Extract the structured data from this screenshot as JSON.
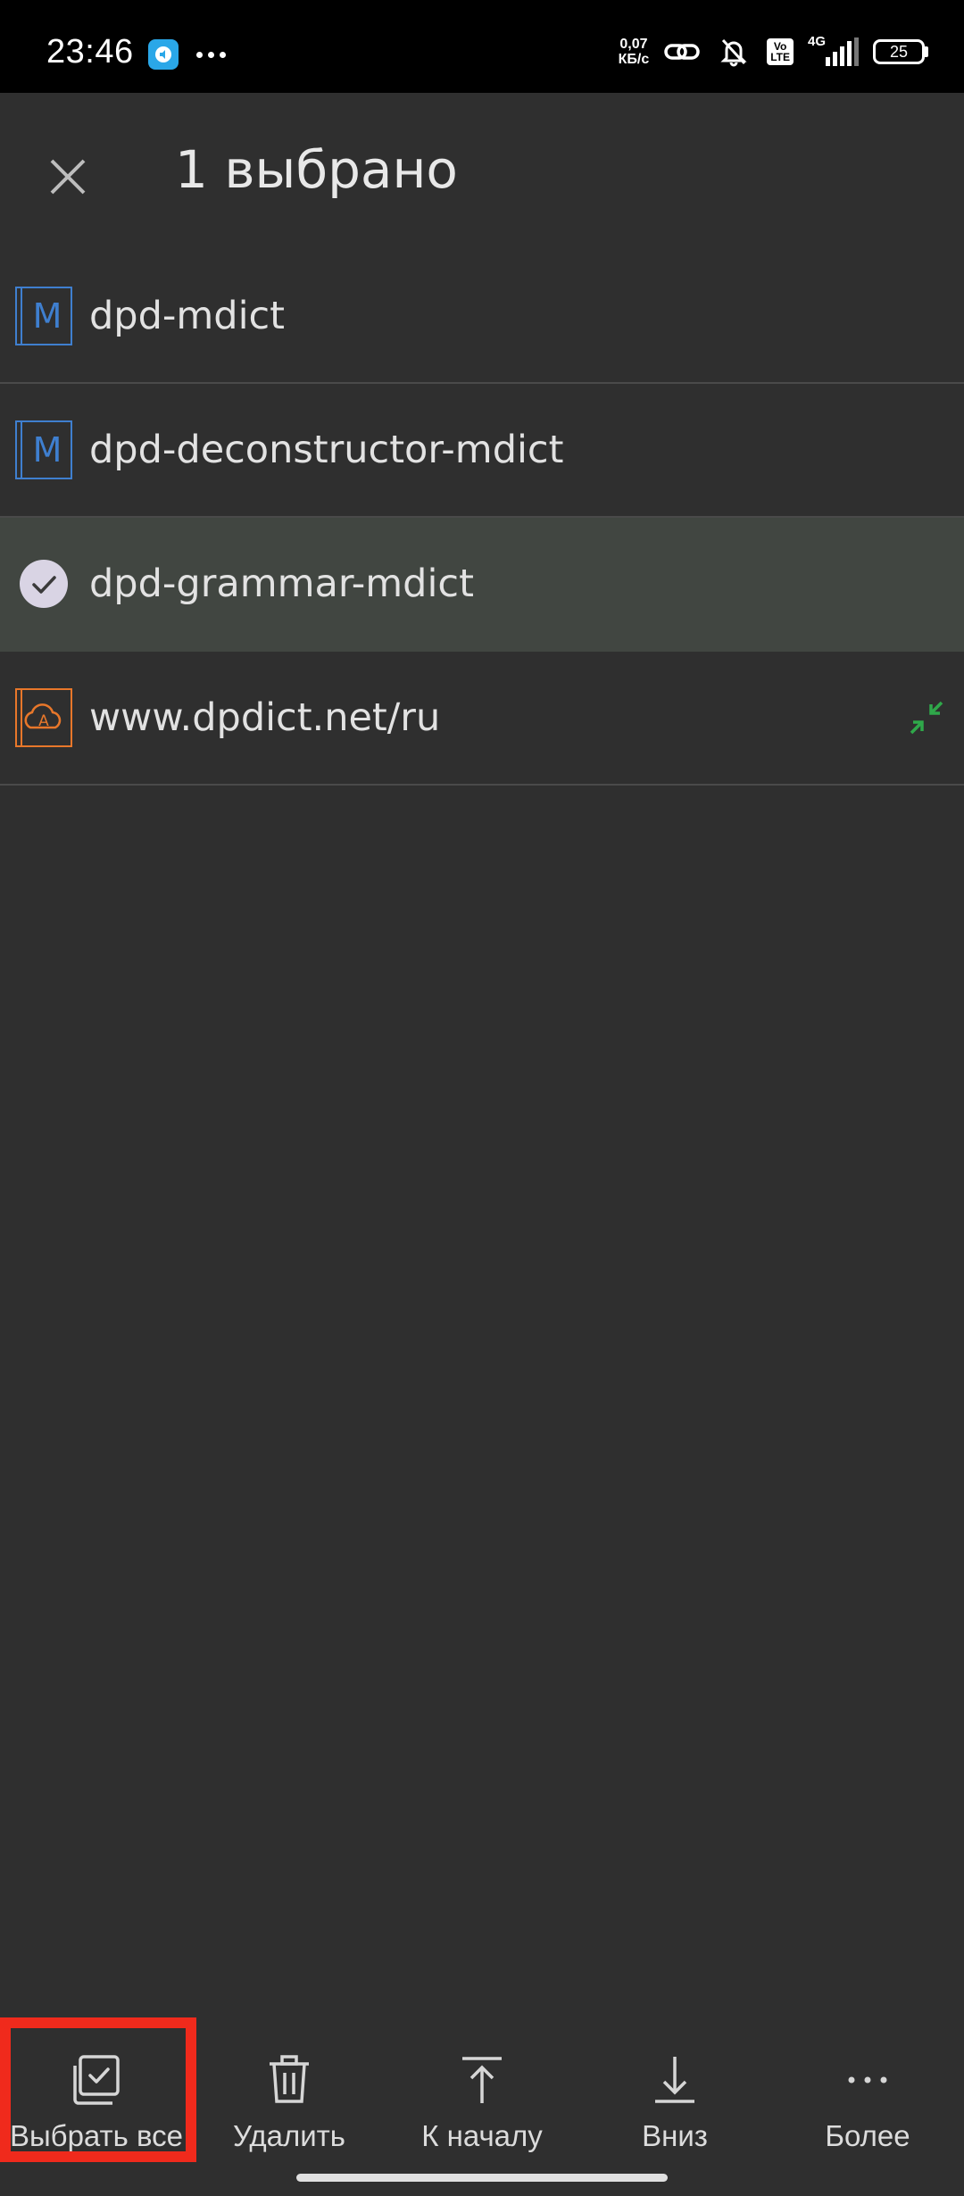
{
  "status_bar": {
    "time": "23:46",
    "net_speed_value": "0,07",
    "net_speed_unit": "КБ/с",
    "volte_top": "Vo",
    "volte_bottom": "LTE",
    "network_type": "4G",
    "battery": "25",
    "icons": [
      "app-notification-icon",
      "more-notifications-icon",
      "link-icon",
      "bell-off-icon",
      "volte-icon",
      "signal-icon",
      "battery-icon"
    ]
  },
  "header": {
    "title": "1 выбрано",
    "close_icon": "close-icon"
  },
  "list": {
    "items": [
      {
        "label": "dpd-mdict",
        "icon": "mdict-icon",
        "selected": false
      },
      {
        "label": "dpd-deconstructor-mdict",
        "icon": "mdict-icon",
        "selected": false
      },
      {
        "label": "dpd-grammar-mdict",
        "icon": "check-circle-icon",
        "selected": true
      },
      {
        "label": "www.dpdict.net/ru",
        "icon": "online-dict-icon",
        "trailing_icon": "collapse-icon",
        "selected": false
      }
    ]
  },
  "toolbar": {
    "select_all": "Выбрать все",
    "delete": "Удалить",
    "to_top": "К началу",
    "down": "Вниз",
    "more": "Более"
  },
  "colors": {
    "background": "#2f2f2f",
    "selected_row": "#414641",
    "mdict_blue": "#3f7fcf",
    "online_orange": "#e8772a",
    "collapse_green": "#2fa84a",
    "highlight_red": "#f02a1c"
  }
}
